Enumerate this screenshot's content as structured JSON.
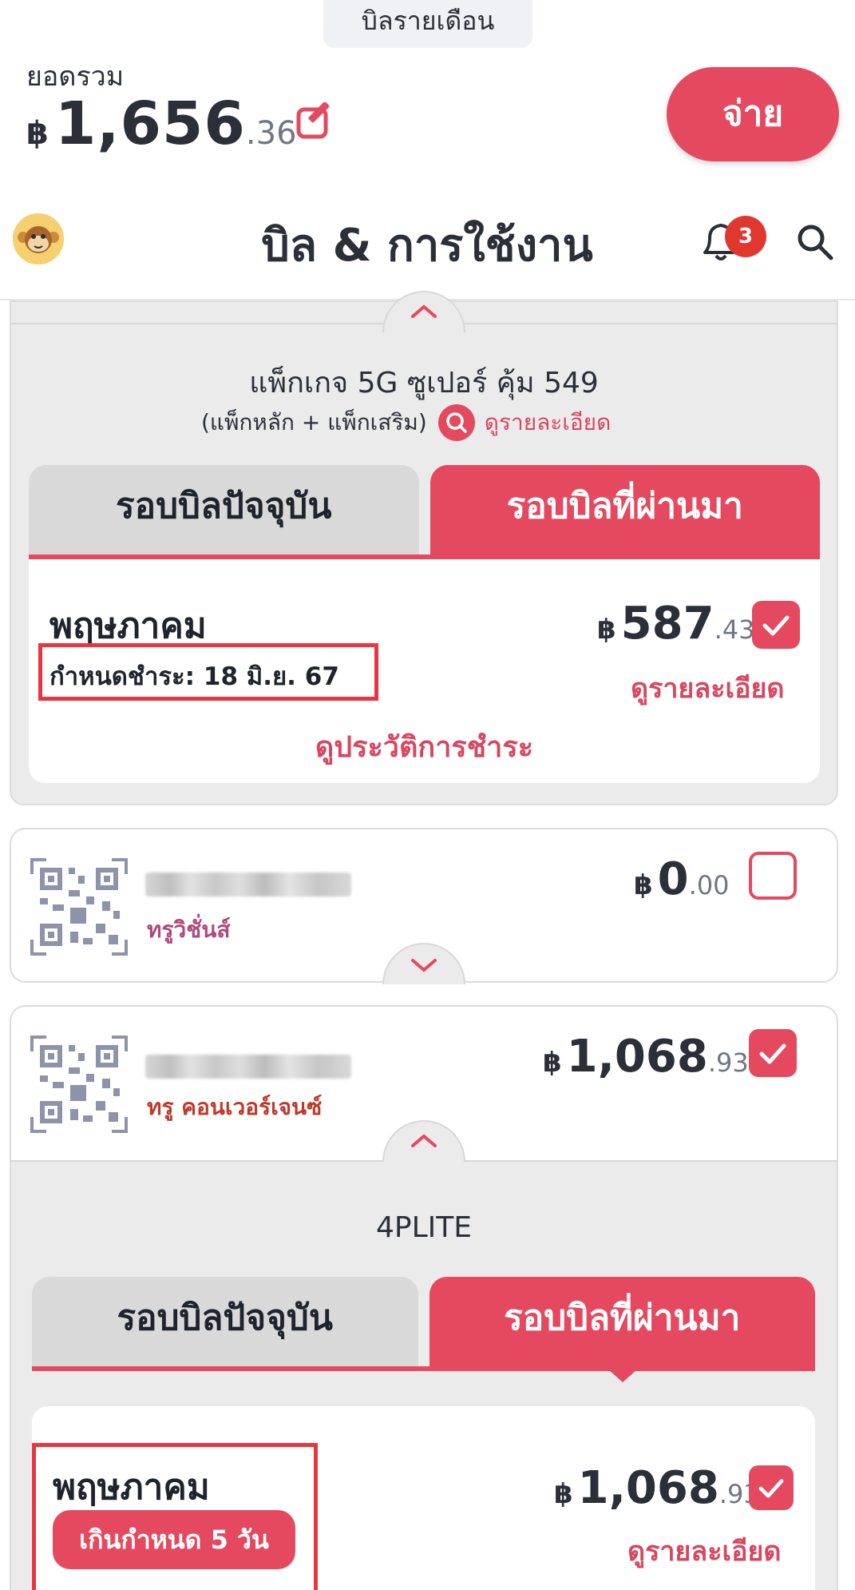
{
  "top": {
    "tab_label": "บิลรายเดือน",
    "total_label": "ยอดรวม",
    "currency": "฿",
    "total_int": "1,656",
    "total_dec": ".36",
    "pay_label": "จ่าย"
  },
  "header": {
    "title": "บิล & การใช้งาน",
    "notification_count": "3"
  },
  "accounts": [
    {
      "package_name": "แพ็กเกจ 5G ซูเปอร์ คุ้ม 549",
      "package_sub": "(แพ็กหลัก +  แพ็กเสริม)",
      "detail_link": "ดูรายละเอียด",
      "tab_current": "รอบบิลปัจจุบัน",
      "tab_past": "รอบบิลที่ผ่านมา",
      "bill": {
        "month": "พฤษภาคม",
        "due": "กำหนดชำระ: 18 มิ.ย. 67",
        "amount_int": "587",
        "amount_dec": ".43",
        "detail": "ดูรายละเอียด",
        "checked": true,
        "history": "ดูประวัติการชำระ"
      }
    },
    {
      "brand": "ทรูวิชั่นส์",
      "amount_int": "0",
      "amount_dec": ".00",
      "checked": false
    },
    {
      "brand": "ทรู คอนเวอร์เจนซ์",
      "amount_int": "1,068",
      "amount_dec": ".93",
      "checked": true,
      "package_name": "4PLITE",
      "tab_current": "รอบบิลปัจจุบัน",
      "tab_past": "รอบบิลที่ผ่านมา",
      "bill": {
        "month": "พฤษภาคม",
        "overdue": "เกินกำหนด 5 วัน",
        "amount_int": "1,068",
        "amount_dec": ".93",
        "detail": "ดูรายละเอียด",
        "checked": true
      }
    }
  ],
  "colors": {
    "accent": "#e5495f",
    "highlight_box": "#e8363f",
    "badge": "#e0382f",
    "brand_truevisions": "#b0487c",
    "brand_true": "#c0392b"
  },
  "icons": [
    "edit-icon",
    "monkey-avatar",
    "bell-icon",
    "search-icon",
    "magnifier-circle-icon",
    "qr-code-icon",
    "chevron-up-icon",
    "chevron-down-icon",
    "check-icon"
  ]
}
